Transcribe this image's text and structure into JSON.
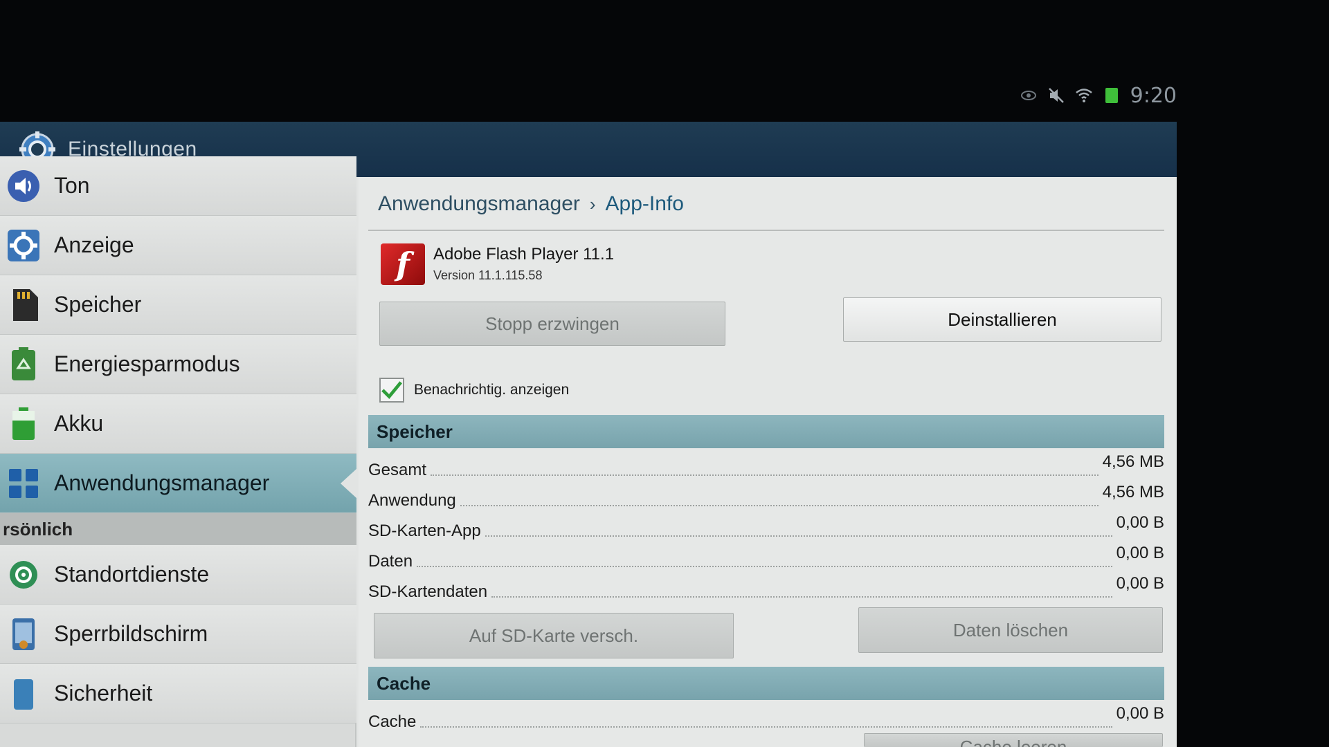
{
  "status_bar": {
    "time": "9:20",
    "icons": [
      "eye-icon",
      "mute-icon",
      "wifi-icon",
      "battery-icon"
    ]
  },
  "action_bar": {
    "title": "Einstellungen",
    "icon": "gear-icon"
  },
  "sidebar": {
    "items": [
      {
        "label": "Ton",
        "icon": "speaker-icon"
      },
      {
        "label": "Anzeige",
        "icon": "display-gear-icon"
      },
      {
        "label": "Speicher",
        "icon": "sd-card-icon"
      },
      {
        "label": "Energiesparmodus",
        "icon": "recycle-icon"
      },
      {
        "label": "Akku",
        "icon": "battery-icon"
      },
      {
        "label": "Anwendungsmanager",
        "icon": "apps-grid-icon"
      }
    ],
    "section": "rsönlich",
    "items_personal": [
      {
        "label": "Standortdienste",
        "icon": "location-icon"
      },
      {
        "label": "Sperrbildschirm",
        "icon": "lock-screen-icon"
      },
      {
        "label": "Sicherheit",
        "icon": "shield-icon"
      }
    ]
  },
  "breadcrumb": {
    "parent": "Anwendungsmanager",
    "current": "App-Info"
  },
  "app": {
    "name": "Adobe Flash Player 11.1",
    "version": "Version 11.1.115.58",
    "icon_glyph": "f"
  },
  "buttons": {
    "force_stop": "Stopp erzwingen",
    "uninstall": "Deinstallieren",
    "move_sd": "Auf SD-Karte versch.",
    "clear_data": "Daten löschen",
    "clear_cache": "Cache leeren"
  },
  "notification_checkbox": {
    "label": "Benachrichtig. anzeigen",
    "checked": true
  },
  "storage": {
    "header": "Speicher",
    "rows": [
      {
        "label": "Gesamt",
        "value": "4,56 MB"
      },
      {
        "label": "Anwendung",
        "value": "4,56 MB"
      },
      {
        "label": "SD-Karten-App",
        "value": "0,00 B"
      },
      {
        "label": "Daten",
        "value": "0,00 B"
      },
      {
        "label": "SD-Kartendaten",
        "value": "0,00 B"
      }
    ]
  },
  "cache": {
    "header": "Cache",
    "rows": [
      {
        "label": "Cache",
        "value": "0,00 B"
      }
    ]
  },
  "colors": {
    "action_bar": "#1f3c53",
    "accent_teal": "#8db6be",
    "check_green": "#2e9e3a",
    "flash_red": "#d12626"
  }
}
